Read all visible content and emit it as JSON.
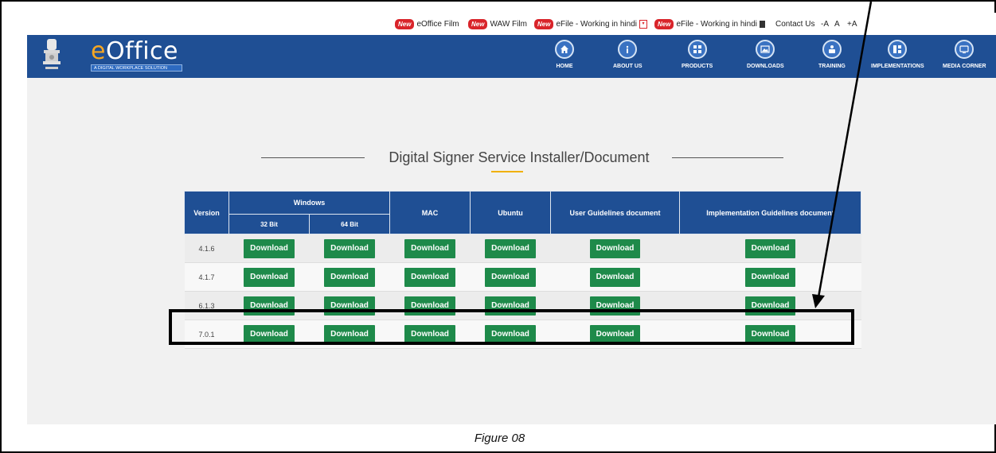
{
  "topbar": {
    "items": [
      {
        "badge": "New",
        "label": "eOffice Film"
      },
      {
        "badge": "New",
        "label": "WAW Film"
      },
      {
        "badge": "New",
        "label": "eFile - Working in hindi"
      },
      {
        "badge": "New",
        "label": "eFile - Working in hindi"
      }
    ],
    "contact": "Contact Us",
    "font_small": "-A",
    "font_normal": "A",
    "font_large": "+A"
  },
  "header": {
    "logo": "eOffice",
    "logo_first": "e",
    "logo_rest": "Office",
    "tagline": "A DIGITAL WORKPLACE SOLUTION"
  },
  "nav": {
    "items": [
      {
        "label": "HOME",
        "icon": "home-icon"
      },
      {
        "label": "ABOUT US",
        "icon": "info-icon"
      },
      {
        "label": "PRODUCTS",
        "icon": "grid-icon"
      },
      {
        "label": "DOWNLOADS",
        "icon": "image-icon"
      },
      {
        "label": "TRAINING",
        "icon": "training-icon"
      },
      {
        "label": "IMPLEMENTATIONS",
        "icon": "implementations-icon"
      },
      {
        "label": "MEDIA CORNER",
        "icon": "media-icon"
      }
    ]
  },
  "page": {
    "title": "Digital Signer Service Installer/Document"
  },
  "table": {
    "headers": {
      "version": "Version",
      "windows": "Windows",
      "bit32": "32 Bit",
      "bit64": "64 Bit",
      "mac": "MAC",
      "ubuntu": "Ubuntu",
      "user_guide": "User Guidelines document",
      "impl_guide": "Implementation Guidelines document"
    },
    "button_label": "Download",
    "rows": [
      {
        "version": "4.1.6"
      },
      {
        "version": "4.1.7"
      },
      {
        "version": "6.1.3"
      },
      {
        "version": "7.0.1"
      }
    ]
  },
  "caption": "Figure 08",
  "colors": {
    "nav_blue": "#1f4f94",
    "download_green": "#1e8a4a",
    "new_badge_red": "#d9242a"
  }
}
